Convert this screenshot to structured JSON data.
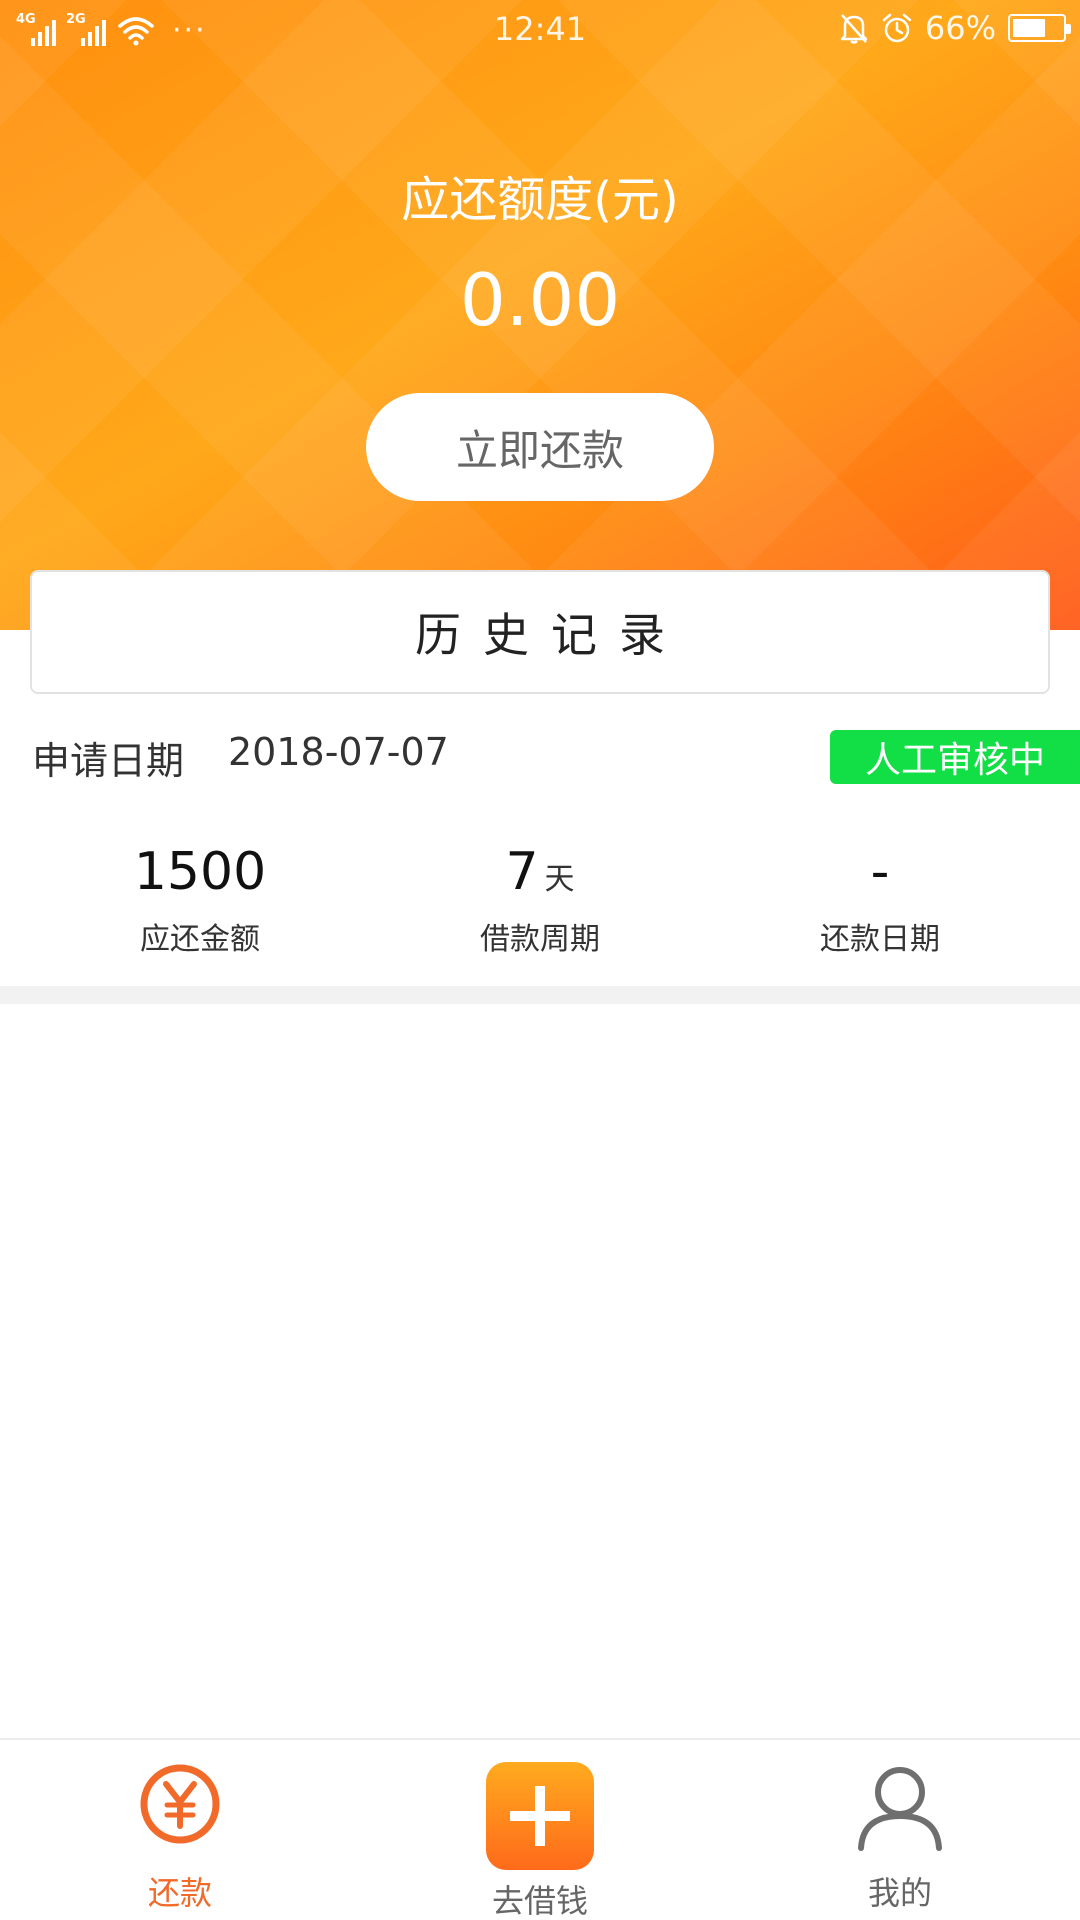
{
  "status_bar": {
    "network1": "4G",
    "network2": "2G",
    "dots": "···",
    "time": "12:41",
    "battery_percent": "66%",
    "battery_level": 0.66
  },
  "header": {
    "amount_label": "应还额度(元)",
    "amount_value": "0.00",
    "repay_button": "立即还款"
  },
  "history": {
    "title": "历史记录"
  },
  "record": {
    "date_label": "申请日期",
    "date": "2018-07-07",
    "status": "人工审核中",
    "stats": [
      {
        "value": "1500",
        "unit": "",
        "label": "应还金额"
      },
      {
        "value": "7",
        "unit": "天",
        "label": "借款周期"
      },
      {
        "value": "-",
        "unit": "",
        "label": "还款日期"
      }
    ]
  },
  "nav": {
    "items": [
      {
        "label": "还款",
        "icon": "yuan-circle-icon"
      },
      {
        "label": "去借钱",
        "icon": "plus-square-icon"
      },
      {
        "label": "我的",
        "icon": "user-icon"
      }
    ]
  },
  "colors": {
    "accent": "#f26a2a",
    "header_orange": "#ffa81a",
    "status_green": "#12de45"
  }
}
